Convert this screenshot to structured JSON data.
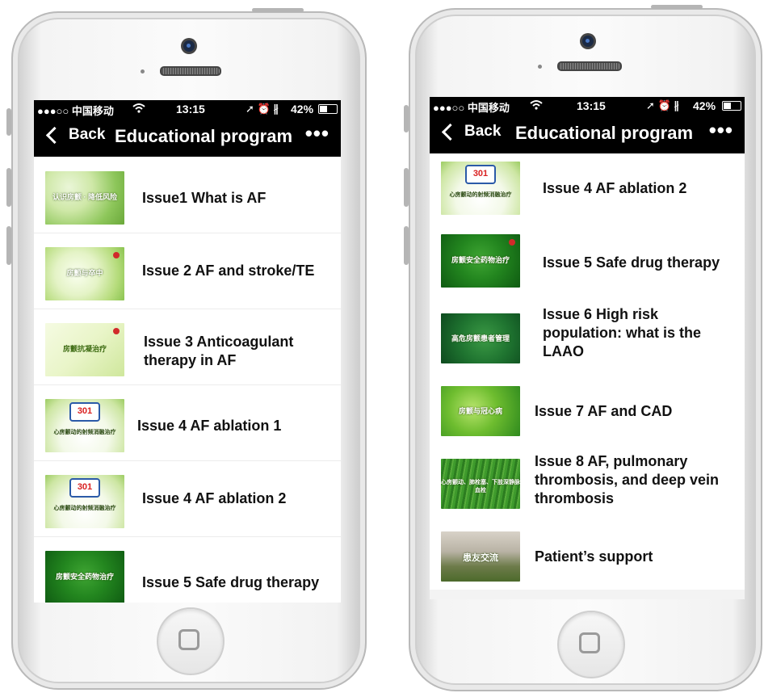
{
  "phones": [
    {
      "status": {
        "carrier": "●●●○○ 中国移动",
        "wifi": "wifi-icon",
        "time": "13:15",
        "battery_text": "42%"
      },
      "nav": {
        "back_label": "Back",
        "title": "Educational program",
        "more_label": "•••"
      },
      "items": [
        {
          "label": "Issue1 What is AF",
          "thumb_text": "认识房颤 · 降低风险",
          "thumb_style": "t-light"
        },
        {
          "label": "Issue 2 AF and stroke/TE",
          "thumb_text": "房颤与卒中",
          "thumb_style": "t-light2"
        },
        {
          "label": "Issue 3 Anticoagulant therapy in AF",
          "thumb_text": "房颤抗凝治疗",
          "thumb_style": "t-pale"
        },
        {
          "label": "Issue 4 AF ablation 1",
          "thumb_text": "心房颤动的射频消融治疗",
          "thumb_style": "t-logo"
        },
        {
          "label": "Issue 4 AF ablation 2",
          "thumb_text": "心房颤动的射频消融治疗",
          "thumb_style": "t-logo"
        },
        {
          "label": "Issue 5  Safe drug therapy",
          "thumb_text": "房颤安全药物治疗",
          "thumb_style": "t-dark"
        }
      ]
    },
    {
      "status": {
        "carrier": "●●●○○ 中国移动",
        "wifi": "wifi-icon",
        "time": "13:15",
        "battery_text": "42%"
      },
      "nav": {
        "back_label": "Back",
        "title": "Educational program",
        "more_label": "•••"
      },
      "items": [
        {
          "label": "Issue 4 AF ablation 2",
          "thumb_text": "心房颤动的射频消融治疗",
          "thumb_style": "t-logo"
        },
        {
          "label": "Issue 5  Safe drug therapy",
          "thumb_text": "房颤安全药物治疗",
          "thumb_style": "t-dark"
        },
        {
          "label": "Issue 6  High risk population: what is the LAAO",
          "thumb_text": "高危房颤患者管理",
          "thumb_style": "t-drop"
        },
        {
          "label": "Issue 7  AF and CAD",
          "thumb_text": "房颤与冠心病",
          "thumb_style": "t-bright"
        },
        {
          "label": "Issue 8  AF, pulmonary thrombosis, and deep vein thrombosis",
          "thumb_text": "心房颤动、肺栓塞、下肢深静脉血栓",
          "thumb_style": "t-grass"
        },
        {
          "label": "Patient’s support",
          "thumb_text": "患友交流",
          "thumb_style": "t-support"
        }
      ]
    }
  ]
}
